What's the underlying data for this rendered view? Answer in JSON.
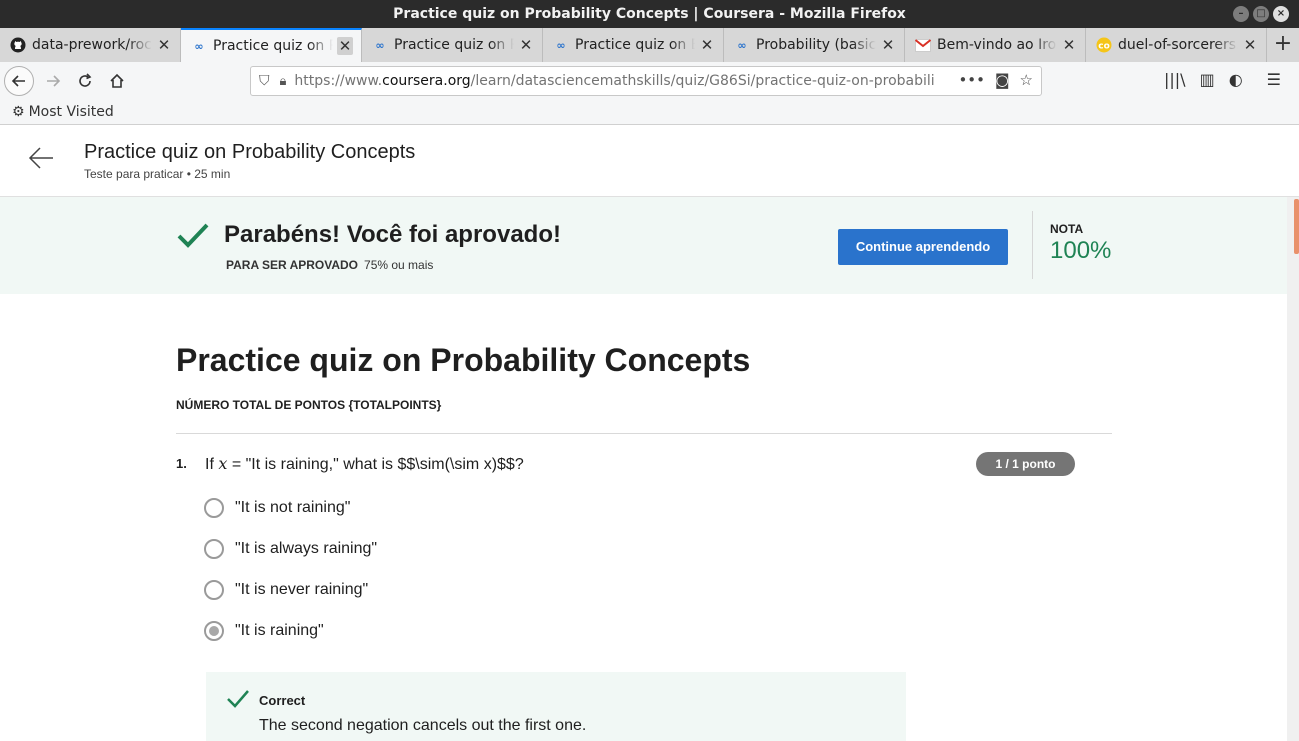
{
  "window": {
    "title": "Practice quiz on Probability Concepts | Coursera - Mozilla Firefox"
  },
  "tabs": [
    {
      "label": "data-prework/rock",
      "icon": "github-icon",
      "active": false
    },
    {
      "label": "Practice quiz on Pr",
      "icon": "coursera-icon",
      "active": true
    },
    {
      "label": "Practice quiz on Pr",
      "icon": "coursera-icon",
      "active": false
    },
    {
      "label": "Practice quiz on Ba",
      "icon": "coursera-icon",
      "active": false
    },
    {
      "label": "Probability (basic c",
      "icon": "coursera-icon",
      "active": false
    },
    {
      "label": "Bem-vindo ao Iron",
      "icon": "gmail-icon",
      "active": false
    },
    {
      "label": "duel-of-sorcerers.i",
      "icon": "codepen-icon",
      "active": false
    }
  ],
  "url": {
    "prefix": "https://www.",
    "domain": "coursera.org",
    "path": "/learn/datasciencemathskills/quiz/G86Si/practice-quiz-on-probabili"
  },
  "bookmarks": {
    "most_visited": "Most Visited"
  },
  "header": {
    "title": "Practice quiz on Probability Concepts",
    "subtitle": "Teste para praticar • 25 min"
  },
  "banner": {
    "message": "Parabéns! Você foi aprovado!",
    "pass_label": "PARA SER APROVADO",
    "pass_value": "75% ou mais",
    "continue_label": "Continue aprendendo",
    "grade_label": "NOTA",
    "grade_value": "100%",
    "accent": "#1f8354",
    "button_color": "#2a73cc"
  },
  "quiz": {
    "title": "Practice quiz on Probability Concepts",
    "total_points": "NÚMERO TOTAL DE PONTOS {TOTALPOINTS}",
    "question": {
      "number": "1.",
      "text_before": "If ",
      "math_var": "x",
      "math_eq": " = ",
      "text_after": "\"It is raining,\" what is $$\\sim(\\sim x)$$?",
      "score": "1 / 1 ponto",
      "options": [
        {
          "label": "\"It is not raining\"",
          "selected": false
        },
        {
          "label": "\"It is always raining\"",
          "selected": false
        },
        {
          "label": "\"It is never raining\"",
          "selected": false
        },
        {
          "label": "\"It is raining\"",
          "selected": true
        }
      ],
      "feedback": {
        "title": "Correct",
        "text": "The second negation cancels out the first one."
      }
    }
  }
}
